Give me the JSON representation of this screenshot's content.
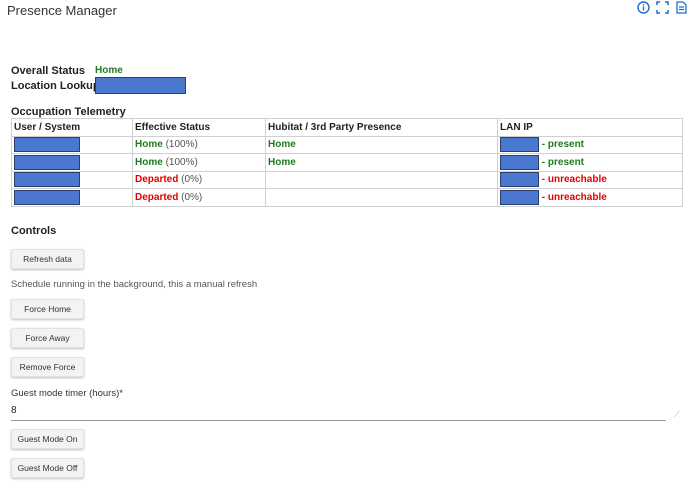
{
  "app": {
    "title": "Presence Manager"
  },
  "header_icons": [
    "info-icon",
    "fullscreen-icon",
    "docs-icon"
  ],
  "overall": {
    "label": "Overall Status",
    "value": "Home",
    "lookup_label": "Location Lookup"
  },
  "telemetry": {
    "title": "Occupation Telemetry",
    "columns": [
      "User / System",
      "Effective Status",
      "Hubitat / 3rd Party Presence",
      "LAN IP"
    ],
    "rows": [
      {
        "status": "Home",
        "pct": "(100%)",
        "hubitat": "Home",
        "lan": "- present"
      },
      {
        "status": "Home",
        "pct": "(100%)",
        "hubitat": "Home",
        "lan": "- present"
      },
      {
        "status": "Departed",
        "pct": "(0%)",
        "hubitat": "",
        "lan": "- unreachable"
      },
      {
        "status": "Departed",
        "pct": "(0%)",
        "hubitat": "",
        "lan": "- unreachable"
      }
    ]
  },
  "controls": {
    "title": "Controls",
    "refresh": "Refresh data",
    "note": "Schedule running in the background, this a manual refresh",
    "force_home": "Force Home",
    "force_away": "Force Away",
    "remove_force": "Remove Force",
    "guest_label": "Guest mode timer (hours)*",
    "guest_value": "8",
    "guest_on": "Guest Mode On",
    "guest_off": "Guest Mode Off"
  },
  "colors": {
    "green": "#1f7a1f",
    "red": "#e00000",
    "redaction": "#4a78cf",
    "icon": "#1a6fc9"
  }
}
